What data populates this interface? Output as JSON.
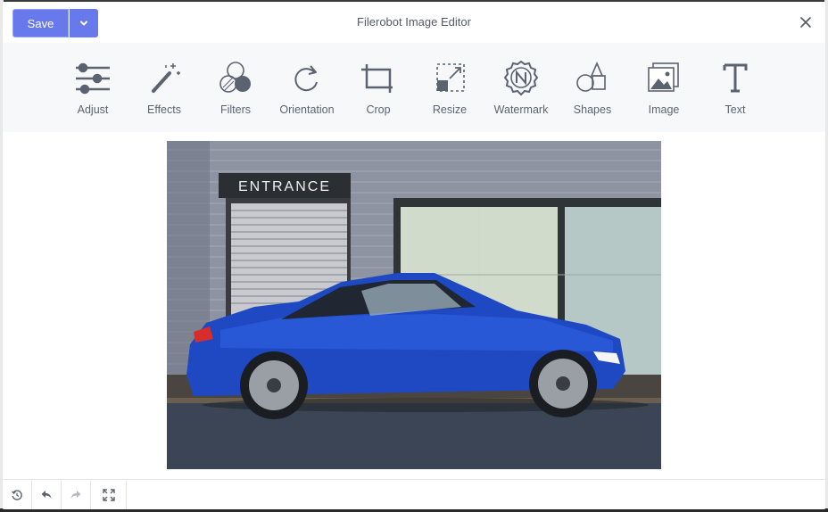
{
  "header": {
    "title": "Filerobot Image Editor",
    "save_label": "Save"
  },
  "tools": [
    {
      "label": "Adjust",
      "icon": "sliders-icon"
    },
    {
      "label": "Effects",
      "icon": "magic-wand-icon"
    },
    {
      "label": "Filters",
      "icon": "filters-circles-icon"
    },
    {
      "label": "Orientation",
      "icon": "rotate-icon"
    },
    {
      "label": "Crop",
      "icon": "crop-icon"
    },
    {
      "label": "Resize",
      "icon": "resize-icon"
    },
    {
      "label": "Watermark",
      "icon": "watermark-icon"
    },
    {
      "label": "Shapes",
      "icon": "shapes-icon"
    },
    {
      "label": "Image",
      "icon": "image-icon"
    },
    {
      "label": "Text",
      "icon": "text-icon"
    }
  ],
  "photo": {
    "sign_text": "ENTRANCE"
  },
  "bottom_bar": [
    {
      "icon": "reset-icon"
    },
    {
      "icon": "undo-icon"
    },
    {
      "icon": "redo-icon"
    },
    {
      "icon": "fullscreen-icon"
    }
  ],
  "colors": {
    "accent": "#6879eb",
    "icon": "#5c6370",
    "toolbar_bg": "#f7f8fa"
  }
}
